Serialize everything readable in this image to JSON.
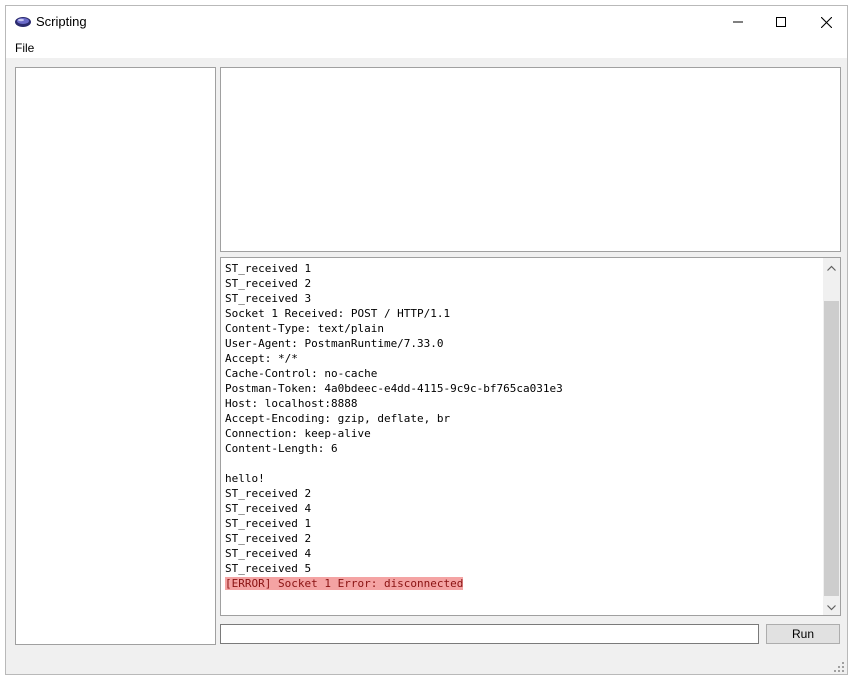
{
  "window": {
    "title": "Scripting",
    "controls": {
      "minimize": "minimize-icon",
      "maximize": "maximize-icon",
      "close": "close-icon"
    }
  },
  "menu": {
    "items": [
      "File"
    ]
  },
  "console": {
    "lines": [
      "ST_received 1",
      "ST_received 2",
      "ST_received 3",
      "Socket 1 Received: POST / HTTP/1.1",
      "Content-Type: text/plain",
      "User-Agent: PostmanRuntime/7.33.0",
      "Accept: */*",
      "Cache-Control: no-cache",
      "Postman-Token: 4a0bdeec-e4dd-4115-9c9c-bf765ca031e3",
      "Host: localhost:8888",
      "Accept-Encoding: gzip, deflate, br",
      "Connection: keep-alive",
      "Content-Length: 6",
      "",
      "hello!",
      "ST_received 2",
      "ST_received 4",
      "ST_received 1",
      "ST_received 2",
      "ST_received 4",
      "ST_received 5"
    ],
    "error_line": "[ERROR] Socket 1 Error: disconnected",
    "error_color": "#f4a3a3"
  },
  "command": {
    "value": "",
    "placeholder": "",
    "run_label": "Run"
  }
}
